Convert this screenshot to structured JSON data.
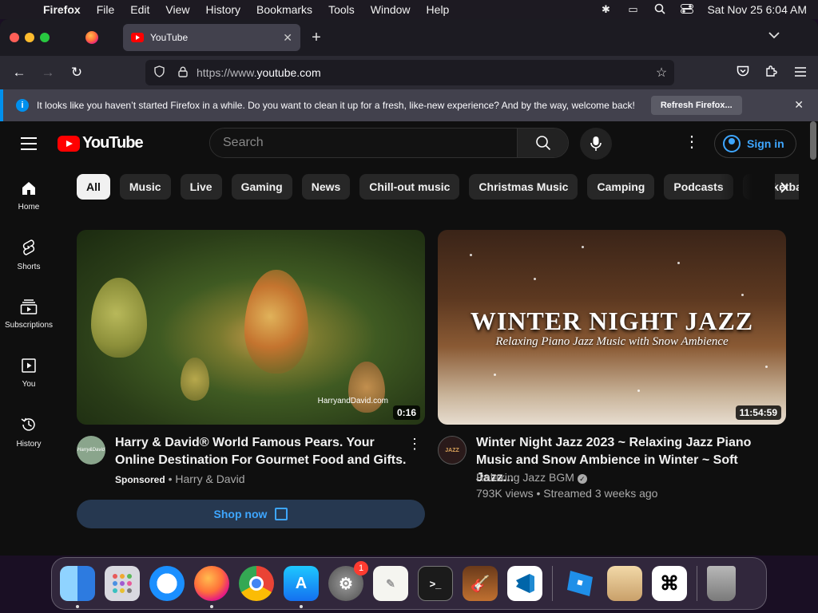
{
  "menubar": {
    "items": [
      "Firefox",
      "File",
      "Edit",
      "View",
      "History",
      "Bookmarks",
      "Tools",
      "Window",
      "Help"
    ],
    "clock": "Sat Nov 25  6:04 AM"
  },
  "browser": {
    "tab_title": "YouTube",
    "url_prefix": "https://www.",
    "url_domain": "youtube.com"
  },
  "notice": {
    "text": "It looks like you haven’t started Firefox in a while. Do you want to clean it up for a fresh, like-new experience? And by the way, welcome back!",
    "button": "Refresh Firefox..."
  },
  "youtube": {
    "logo_text": "YouTube",
    "search_placeholder": "Search",
    "signin_label": "Sign in",
    "rail": [
      {
        "label": "Home",
        "icon": "home-icon"
      },
      {
        "label": "Shorts",
        "icon": "shorts-icon"
      },
      {
        "label": "Subscriptions",
        "icon": "subscriptions-icon"
      },
      {
        "label": "You",
        "icon": "you-icon"
      },
      {
        "label": "History",
        "icon": "history-icon"
      }
    ],
    "chips": [
      "All",
      "Music",
      "Live",
      "Gaming",
      "News",
      "Chill-out music",
      "Christmas Music",
      "Camping",
      "Podcasts",
      "Basketball"
    ],
    "videos": [
      {
        "title": "Harry & David® World Famous Pears. Your Online Destination For Gourmet Food and Gifts.",
        "sponsored_label": "Sponsored",
        "channel": "Harry & David",
        "duration": "0:16",
        "watermark": "HarryandDavid.com",
        "avatar_text": "Harry&David",
        "cta": "Shop now"
      },
      {
        "title": "Winter Night Jazz 2023 ~ Relaxing Jazz Piano Music and Snow Ambience in Winter ~ Soft Jazz...",
        "channel": "Relaxing Jazz BGM",
        "stats": "793K views • Streamed 3 weeks ago",
        "duration": "11:54:59",
        "thumb_title": "WINTER NIGHT JAZZ",
        "thumb_subtitle": "Relaxing Piano Jazz Music with Snow Ambience",
        "avatar_text": "JAZZ"
      }
    ]
  },
  "dock": {
    "apps": [
      "finder-icon",
      "launchpad-icon",
      "safari-icon",
      "firefox-icon",
      "chrome-icon",
      "app-store-icon",
      "system-settings-icon",
      "textedit-icon",
      "terminal-icon",
      "garageband-icon",
      "vscode-icon",
      "roblox-studio-icon",
      "archive-utility-icon",
      "capcut-icon",
      "trash-icon"
    ],
    "settings_badge": "1"
  }
}
